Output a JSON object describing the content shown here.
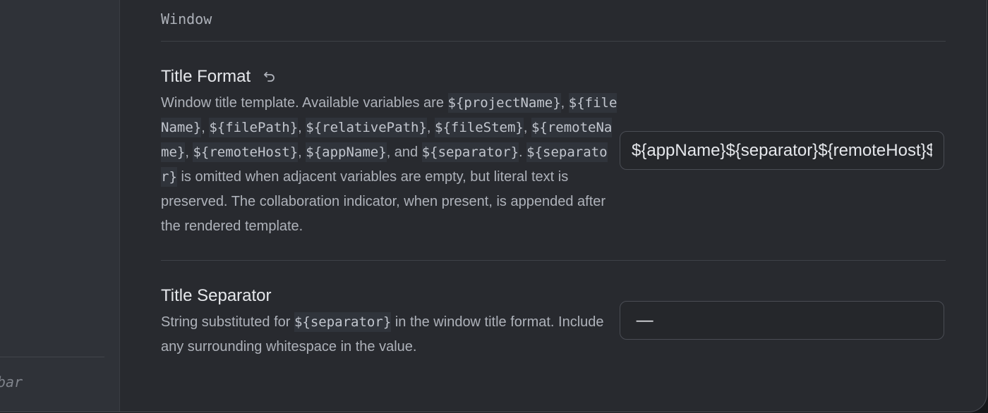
{
  "sidebar": {
    "partial_item_label": "bar"
  },
  "section": {
    "title": "Window"
  },
  "settings": [
    {
      "label": "Title Format",
      "has_reset": true,
      "description_parts": [
        "Window title template. Available variables are ",
        "${projectName}",
        ", ",
        "${fileName}",
        ", ",
        "${filePath}",
        ", ",
        "${relativePath}",
        ", ",
        "${fileStem}",
        ", ",
        "${remoteName}",
        ", ",
        "${remoteHost}",
        ", ",
        "${appName}",
        ", and ",
        "${separator}",
        ". ",
        "${separator}",
        " is omitted when adjacent variables are empty, but literal text is preserved. The collaboration indicator, when present, is appended after the rendered template."
      ],
      "value": "${appName}${separator}${remoteHost}${separator}${projectName}"
    },
    {
      "label": "Title Separator",
      "has_reset": false,
      "description_parts": [
        "String substituted for ",
        "${separator}",
        " in the window title format. Include any surrounding whitespace in the value."
      ],
      "value": " — "
    }
  ],
  "icons": {
    "reset": "undo-arrow-icon"
  },
  "colors": {
    "window_bg": "#282a2f",
    "sidebar_bg": "#2f3238",
    "text_primary": "#e6e8ec",
    "text_secondary": "#aeb2ba"
  }
}
